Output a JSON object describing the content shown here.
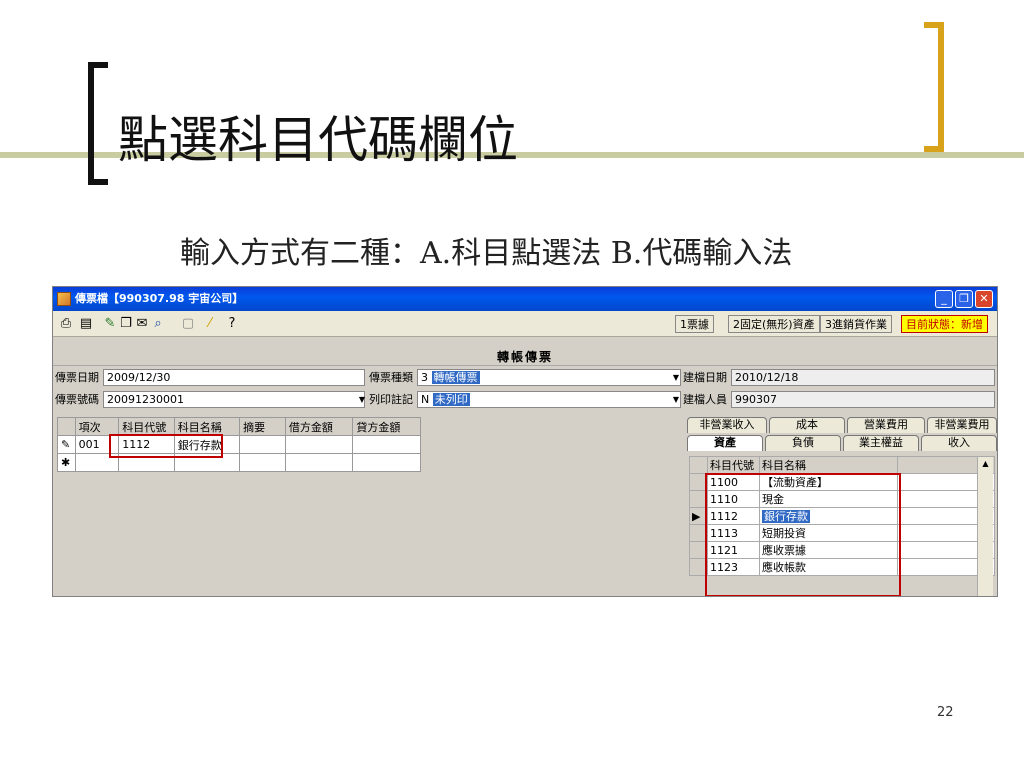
{
  "slide": {
    "title": "點選科目代碼欄位",
    "subtitle": "輸入方式有二種：A.科目點選法 B.代碼輸入法",
    "page_number": "22"
  },
  "window": {
    "title": "傳票檔【990307.98 宇宙公司】",
    "min_label": "_",
    "max_label": "❐",
    "close_label": "✕"
  },
  "toolbar": {
    "icons": [
      "printer-icon",
      "book-icon",
      "edit-icon",
      "copy-icon",
      "mail-icon",
      "search-icon",
      "doc-icon",
      "pencil-icon",
      "help-icon"
    ],
    "tab_buttons": [
      "1票據",
      "2固定(無形)資產",
      "3進銷貨作業"
    ],
    "status": "目前狀態：新增"
  },
  "form": {
    "header": "轉帳傳票",
    "voucher_date_label": "傳票日期",
    "voucher_date": "2009/12/30",
    "voucher_no_label": "傳票號碼",
    "voucher_no": "20091230001",
    "voucher_type_label": "傳票種類",
    "voucher_type_code": "3",
    "voucher_type": "轉帳傳票",
    "print_mark_label": "列印註記",
    "print_mark_code": "N",
    "print_mark": "未列印",
    "created_date_label": "建檔日期",
    "created_date": "2010/12/18",
    "created_by_label": "建檔人員",
    "created_by": "990307"
  },
  "grid": {
    "columns": [
      "項次",
      "科目代號",
      "科目名稱",
      "摘要",
      "借方金額",
      "貸方金額"
    ],
    "rows": [
      {
        "marker": "✎",
        "cells": [
          "001",
          "1112",
          "銀行存款",
          "",
          "",
          ""
        ]
      },
      {
        "marker": "✱",
        "cells": [
          "",
          "",
          "",
          "",
          "",
          ""
        ]
      }
    ]
  },
  "account_panel": {
    "tabs_back": [
      "非營業收入",
      "成本",
      "營業費用",
      "非營業費用"
    ],
    "tabs_front": [
      "資產",
      "負債",
      "業主權益",
      "收入"
    ],
    "columns": [
      "科目代號",
      "科目名稱"
    ],
    "rows": [
      {
        "code": "1100",
        "name": "【流動資產】",
        "selected": false
      },
      {
        "code": "1110",
        "name": "現金",
        "selected": false
      },
      {
        "code": "1112",
        "name": "銀行存款",
        "selected": true
      },
      {
        "code": "1113",
        "name": "短期投資",
        "selected": false
      },
      {
        "code": "1121",
        "name": "應收票據",
        "selected": false
      },
      {
        "code": "1123",
        "name": "應收帳款",
        "selected": false
      }
    ]
  },
  "colors": {
    "accent_bracket": "#d9a21b",
    "highlight_box": "#c00000",
    "title_bar": "#0a3dd9",
    "status_bg": "#ffff00"
  }
}
